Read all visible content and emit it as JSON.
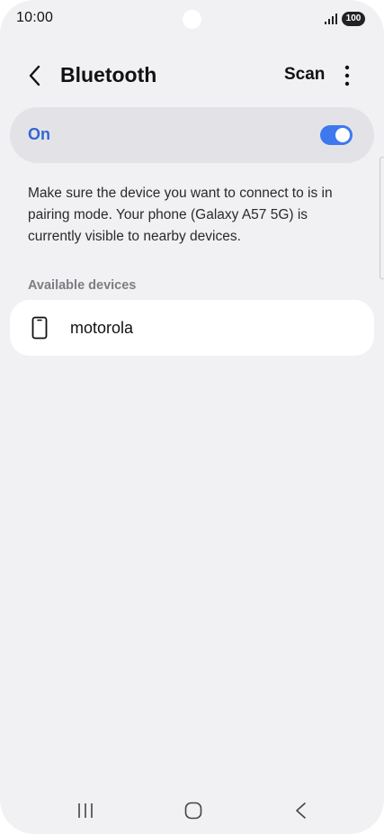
{
  "status_bar": {
    "time": "10:00",
    "battery": "100",
    "icons": [
      "signal-icon",
      "battery-icon"
    ]
  },
  "header": {
    "title": "Bluetooth",
    "scan_label": "Scan",
    "icons": [
      "chevron-left-icon",
      "more-vertical-icon"
    ]
  },
  "toggle": {
    "label": "On",
    "state": "on",
    "accent_color": "#3e78ee",
    "label_color": "#3366d6"
  },
  "description": "Make sure the device you want to connect to is in pairing mode. Your phone (Galaxy A57 5G) is currently visible to nearby devices.",
  "available_devices": {
    "header": "Available devices",
    "items": [
      {
        "name": "motorola",
        "icon": "smartphone-icon"
      }
    ]
  },
  "nav_bar": {
    "icons": [
      "recents-icon",
      "home-icon",
      "back-icon"
    ]
  }
}
